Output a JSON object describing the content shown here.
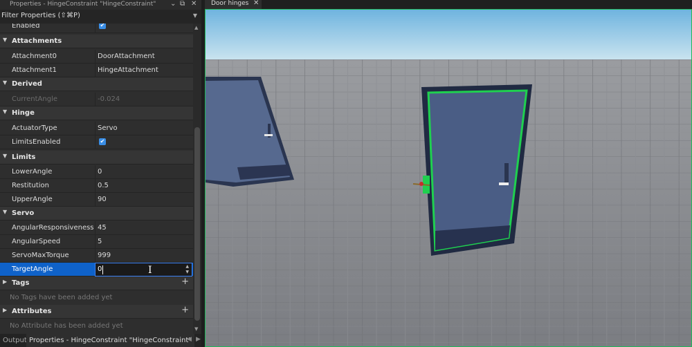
{
  "properties_panel": {
    "title": "Properties - HingeConstraint \"HingeConstraint\"",
    "filter_label": "Filter Properties (⇧⌘P)",
    "rows": {
      "enabled": {
        "name": "Enabled",
        "checked": true
      },
      "attachments_cat": "Attachments",
      "attachment0": {
        "name": "Attachment0",
        "value": "DoorAttachment"
      },
      "attachment1": {
        "name": "Attachment1",
        "value": "HingeAttachment"
      },
      "derived_cat": "Derived",
      "current_angle": {
        "name": "CurrentAngle",
        "value": "-0.024"
      },
      "hinge_cat": "Hinge",
      "actuator_type": {
        "name": "ActuatorType",
        "value": "Servo"
      },
      "limits_enabled": {
        "name": "LimitsEnabled",
        "checked": true
      },
      "limits_cat": "Limits",
      "lower_angle": {
        "name": "LowerAngle",
        "value": "0"
      },
      "restitution": {
        "name": "Restitution",
        "value": "0.5"
      },
      "upper_angle": {
        "name": "UpperAngle",
        "value": "90"
      },
      "servo_cat": "Servo",
      "angular_responsiveness": {
        "name": "AngularResponsiveness",
        "value": "45"
      },
      "angular_speed": {
        "name": "AngularSpeed",
        "value": "5"
      },
      "servo_max_torque": {
        "name": "ServoMaxTorque",
        "value": "999"
      },
      "target_angle": {
        "name": "TargetAngle",
        "value": "0"
      },
      "tags_cat": "Tags",
      "tags_empty": "No Tags have been added yet",
      "attributes_cat": "Attributes",
      "attributes_empty": "No Attribute has been added yet"
    }
  },
  "bottom_tabs": {
    "output": "Output",
    "properties": "Properties - HingeConstraint \"HingeConstraint\""
  },
  "viewport": {
    "tab_label": "Door hinges",
    "selection_color": "#1fd04f",
    "sky_color": "#8ec6e6",
    "door_color": "#4a5d85"
  },
  "icons": {
    "checkbox": "✔",
    "chevron": "▼",
    "add": "+",
    "close": "✕"
  }
}
